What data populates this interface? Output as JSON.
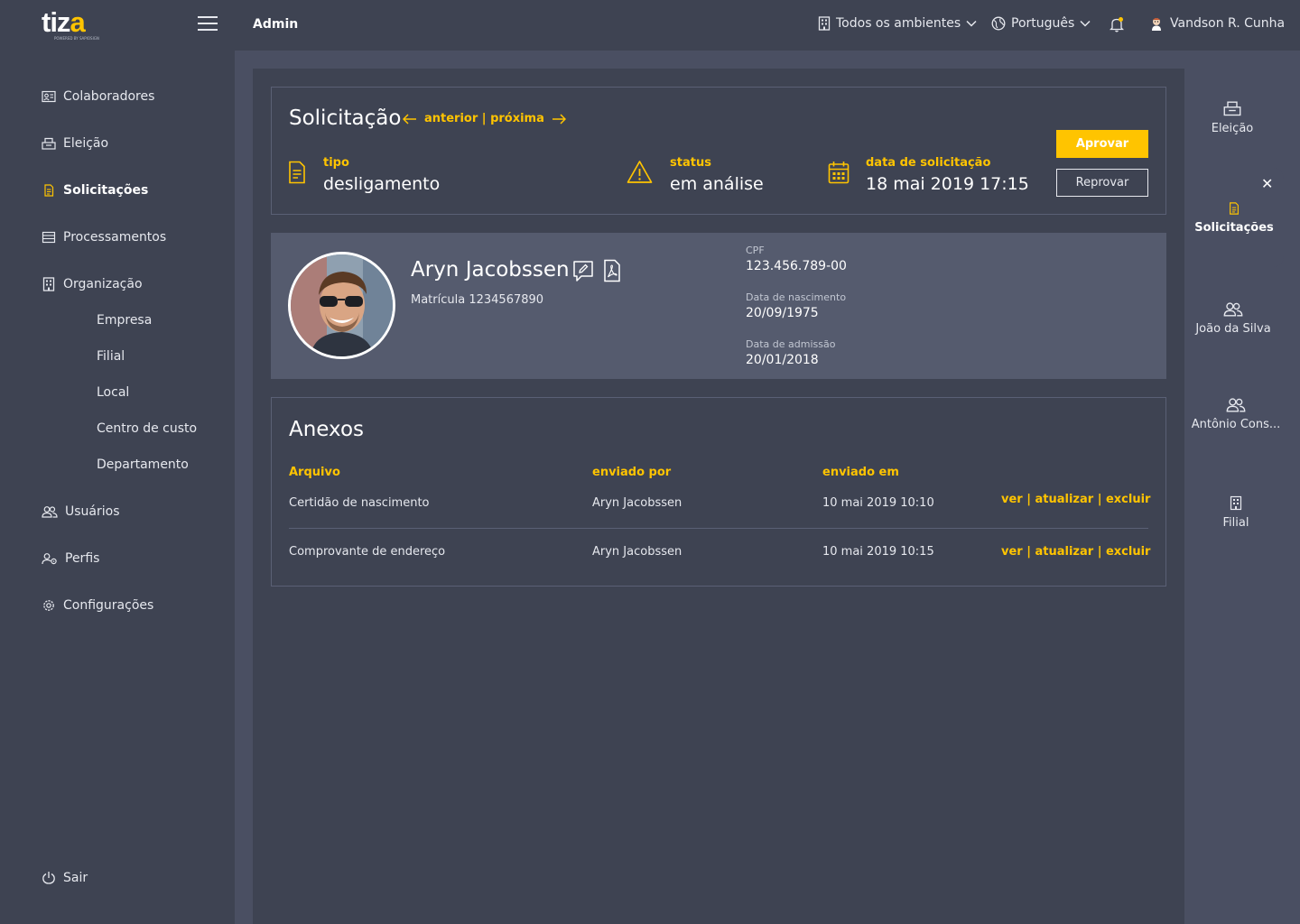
{
  "header": {
    "logo_text": "tiza",
    "logo_sub": "POWERED BY SAPIOSIGN",
    "menu_icon": "hamburger-icon",
    "page_title": "Admin",
    "environment": "Todos os ambientes",
    "language": "Português",
    "user_name": "Vandson R. Cunha"
  },
  "sidebar": {
    "items": [
      {
        "label": "Colaboradores",
        "icon": "id-card-icon"
      },
      {
        "label": "Eleição",
        "icon": "ballot-box-icon"
      },
      {
        "label": "Solicitações",
        "icon": "document-icon"
      },
      {
        "label": "Processamentos",
        "icon": "list-icon"
      },
      {
        "label": "Organização",
        "icon": "building-icon"
      }
    ],
    "org_subitems": [
      "Empresa",
      "Filial",
      "Local",
      "Centro de custo",
      "Departamento"
    ],
    "items_bottom": [
      {
        "label": "Usuários",
        "icon": "users-icon"
      },
      {
        "label": "Perfis",
        "icon": "profile-gear-icon"
      },
      {
        "label": "Configurações",
        "icon": "gear-icon"
      }
    ],
    "logout": "Sair"
  },
  "request": {
    "title": "Solicitação",
    "pager": "anterior | próxima",
    "tipo_label": "tipo",
    "tipo_value": "desligamento",
    "status_label": "status",
    "status_value": "em análise",
    "date_label": "data de solicitação",
    "date_value": "18 mai 2019 17:15",
    "approve": "Aprovar",
    "reject": "Reprovar"
  },
  "employee": {
    "name": "Aryn Jacobssen",
    "matricula": "Matrícula 1234567890",
    "cpf_label": "CPF",
    "cpf": "123.456.789-00",
    "birth_label": "Data de nascimento",
    "birth": "20/09/1975",
    "admission_label": "Data de admissão",
    "admission": "20/01/2018"
  },
  "attachments": {
    "title": "Anexos",
    "columns": [
      "Arquivo",
      "enviado por",
      "enviado em"
    ],
    "rows": [
      {
        "file": "Certidão de nascimento",
        "by": "Aryn Jacobssen",
        "at": "10 mai 2019 10:10",
        "actions": "ver | atualizar | excluir"
      },
      {
        "file": "Comprovante de endereço",
        "by": "Aryn Jacobssen",
        "at": "10 mai 2019 10:15",
        "actions": "ver | atualizar | excluir"
      }
    ]
  },
  "right_panel": {
    "items": [
      {
        "label": "Eleição",
        "icon": "ballot-box-icon"
      },
      {
        "label": "Solicitações",
        "icon": "document-icon"
      },
      {
        "label": "João da Silva",
        "icon": "users-icon"
      },
      {
        "label": "Antônio Cons...",
        "icon": "users-icon"
      },
      {
        "label": "Filial",
        "icon": "building-icon"
      }
    ]
  },
  "colors": {
    "accent": "#ffc400",
    "background": "#3e4352",
    "panel": "#4a4f62",
    "card": "#555b6e"
  }
}
